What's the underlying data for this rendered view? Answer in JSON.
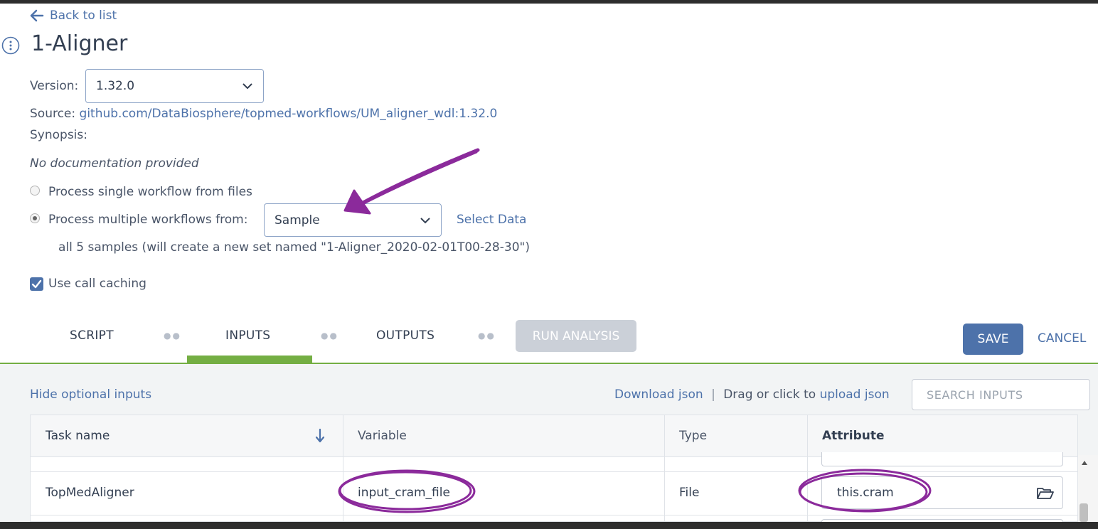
{
  "nav": {
    "back_label": "Back to list"
  },
  "workflow": {
    "title": "1-Aligner",
    "version_label": "Version:",
    "version_value": "1.32.0",
    "source_label": "Source:",
    "source_link": "github.com/DataBiosphere/topmed-workflows/UM_aligner_wdl:1.32.0",
    "synopsis_label": "Synopsis:",
    "documentation": "No documentation provided"
  },
  "process": {
    "single_label": "Process single workflow from files",
    "multiple_label": "Process multiple workflows from:",
    "entity_value": "Sample",
    "select_data_label": "Select Data",
    "summary": "all 5 samples (will create a new set named \"1-Aligner_2020-02-01T00-28-30\")",
    "call_caching_label": "Use call caching",
    "call_caching_checked": true,
    "selected_option": "multiple"
  },
  "tabs": [
    {
      "label": "SCRIPT",
      "active": false
    },
    {
      "label": "INPUTS",
      "active": true
    },
    {
      "label": "OUTPUTS",
      "active": false
    }
  ],
  "actions": {
    "run_label": "RUN ANALYSIS",
    "save_label": "SAVE",
    "cancel_label": "CANCEL"
  },
  "inputs_panel": {
    "hide_optional_label": "Hide optional inputs",
    "download_json_label": "Download json",
    "separator": "|",
    "upload_prefix": "Drag or click to",
    "upload_json_label": "upload json",
    "search_placeholder": "SEARCH INPUTS"
  },
  "table": {
    "columns": [
      "Task name",
      "Variable",
      "Type",
      "Attribute"
    ],
    "rows": [
      {
        "task": "TopMedAligner",
        "variable": "input_cram_file",
        "type": "File",
        "attribute": "this.cram"
      }
    ]
  },
  "colors": {
    "accent": "#4d72aa",
    "tab_active": "#74ae43",
    "annotation": "#8b2a9b"
  }
}
